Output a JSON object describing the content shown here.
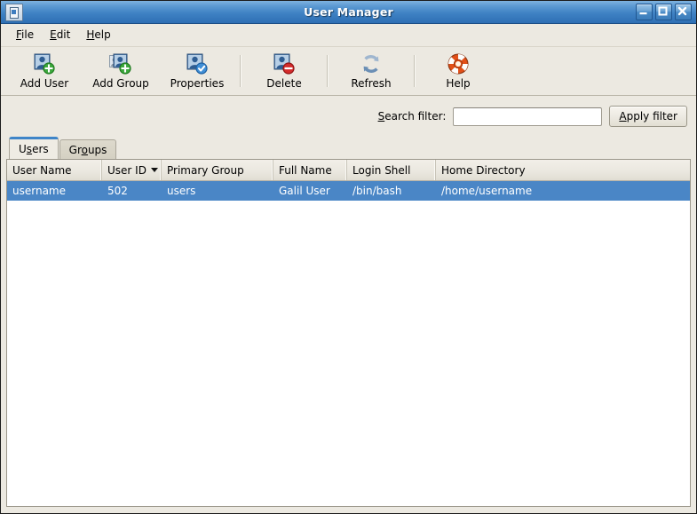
{
  "window": {
    "title": "User Manager",
    "icon": "user-manager-icon",
    "controls": [
      {
        "name": "minimize-button",
        "glyph": "minimize"
      },
      {
        "name": "maximize-button",
        "glyph": "maximize"
      },
      {
        "name": "close-button",
        "glyph": "close"
      }
    ]
  },
  "menu": {
    "items": [
      {
        "label": "File",
        "mnemonic": "F"
      },
      {
        "label": "Edit",
        "mnemonic": "E"
      },
      {
        "label": "Help",
        "mnemonic": "H"
      }
    ]
  },
  "toolbar": {
    "buttons": [
      {
        "label": "Add User",
        "icon": "add-user-icon"
      },
      {
        "label": "Add Group",
        "icon": "add-group-icon"
      },
      {
        "label": "Properties",
        "icon": "properties-icon"
      },
      {
        "label": "Delete",
        "icon": "delete-icon"
      },
      {
        "label": "Refresh",
        "icon": "refresh-icon"
      },
      {
        "label": "Help",
        "icon": "help-icon"
      }
    ]
  },
  "filter": {
    "label_pre": "S",
    "label_post": "earch filter:",
    "value": "",
    "placeholder": "",
    "button_pre": "A",
    "button_post": "pply filter"
  },
  "tabs": [
    {
      "label_pre": "U",
      "label_mid": "s",
      "label_post": "ers",
      "active": true
    },
    {
      "label_pre": "Gr",
      "label_mid": "o",
      "label_post": "ups",
      "active": false
    }
  ],
  "table": {
    "columns": [
      {
        "label": "User Name",
        "sorted": false
      },
      {
        "label": "User ID",
        "sorted": true,
        "direction": "desc"
      },
      {
        "label": "Primary Group",
        "sorted": false
      },
      {
        "label": "Full Name",
        "sorted": false
      },
      {
        "label": "Login Shell",
        "sorted": false
      },
      {
        "label": "Home Directory",
        "sorted": false
      }
    ],
    "rows": [
      {
        "selected": true,
        "cells": [
          "username",
          "502",
          "users",
          "Galil User",
          "/bin/bash",
          "/home/username"
        ]
      }
    ]
  },
  "colors": {
    "titlebar_blue": "#3f82c4",
    "selection_blue": "#4a86c6",
    "tab_accent": "#3f85c8",
    "face": "#ece9e1",
    "list_bg": "#ffffff"
  }
}
